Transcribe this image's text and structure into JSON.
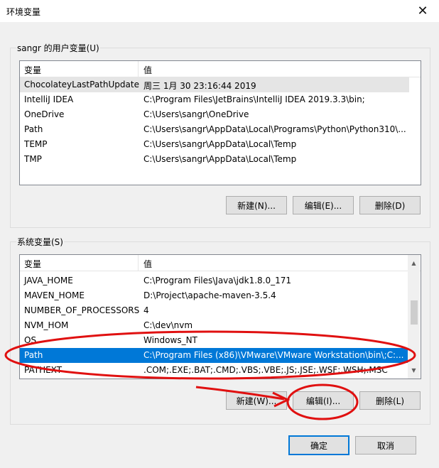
{
  "window": {
    "title": "环境变量",
    "close_glyph": "✕"
  },
  "user_section": {
    "label": "sangr 的用户变量(U)",
    "headers": {
      "variable": "变量",
      "value": "值"
    },
    "rows": [
      {
        "name": "ChocolateyLastPathUpdate",
        "value": "周三 1月 30 23:16:44 2019"
      },
      {
        "name": "IntelliJ IDEA",
        "value": "C:\\Program Files\\JetBrains\\IntelliJ IDEA 2019.3.3\\bin;"
      },
      {
        "name": "OneDrive",
        "value": "C:\\Users\\sangr\\OneDrive"
      },
      {
        "name": "Path",
        "value": "C:\\Users\\sangr\\AppData\\Local\\Programs\\Python\\Python310\\..."
      },
      {
        "name": "TEMP",
        "value": "C:\\Users\\sangr\\AppData\\Local\\Temp"
      },
      {
        "name": "TMP",
        "value": "C:\\Users\\sangr\\AppData\\Local\\Temp"
      }
    ],
    "buttons": {
      "new": "新建(N)...",
      "edit": "编辑(E)...",
      "delete": "删除(D)"
    }
  },
  "system_section": {
    "label": "系统变量(S)",
    "headers": {
      "variable": "变量",
      "value": "值"
    },
    "rows": [
      {
        "name": "JAVA_HOME",
        "value": "C:\\Program Files\\Java\\jdk1.8.0_171"
      },
      {
        "name": "MAVEN_HOME",
        "value": "D:\\Project\\apache-maven-3.5.4"
      },
      {
        "name": "NUMBER_OF_PROCESSORS",
        "value": "4"
      },
      {
        "name": "NVM_HOM",
        "value": "C:\\dev\\nvm"
      },
      {
        "name": "OS",
        "value": "Windows_NT"
      },
      {
        "name": "Path",
        "value": "C:\\Program Files (x86)\\VMware\\VMware Workstation\\bin\\;C:..."
      },
      {
        "name": "PATHEXT",
        "value": ".COM;.EXE;.BAT;.CMD;.VBS;.VBE;.JS;.JSE;.WSF;.WSH;.MSC"
      }
    ],
    "buttons": {
      "new": "新建(W)...",
      "edit": "编辑(I)...",
      "delete": "删除(L)"
    }
  },
  "footer": {
    "ok": "确定",
    "cancel": "取消"
  },
  "colors": {
    "selection": "#0078d7",
    "annotation": "#e01010"
  }
}
